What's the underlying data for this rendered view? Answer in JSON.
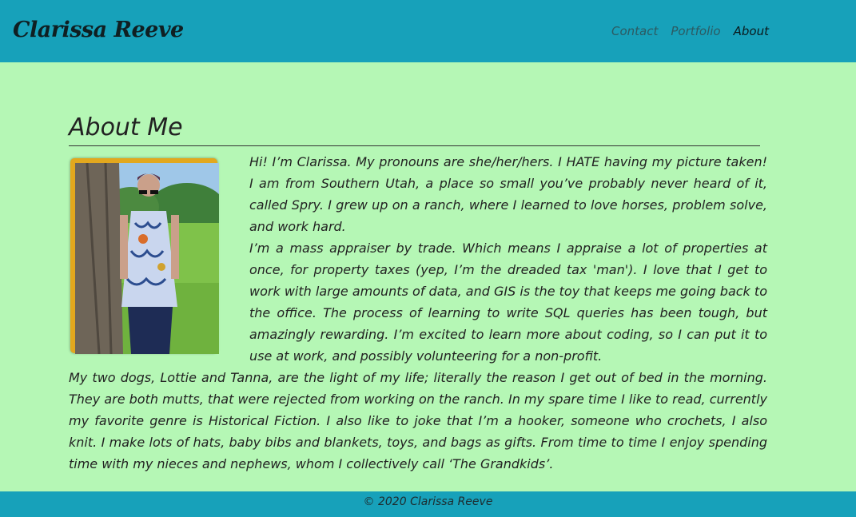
{
  "header": {
    "brand": "Clarissa Reeve",
    "nav": [
      "Contact",
      "Portfolio",
      "About"
    ],
    "active": "About"
  },
  "main": {
    "title": "About Me",
    "paragraphs": [
      "Hi! I’m Clarissa. My pronouns are she/her/hers. I HATE having my picture taken! I am from Southern Utah, a place so small you’ve probably never heard of it, called Spry. I grew up on a ranch, where I learned to love horses, problem solve, and work hard.",
      "I’m a mass appraiser by trade. Which means I appraise a lot of properties at once, for property taxes (yep, I’m the dreaded tax 'man'). I love that I get to work with large amounts of data, and GIS is the toy that keeps me going back to the office. The process of learning to write SQL queries has been tough, but amazingly rewarding. I’m excited to learn more about coding, so I can put it to use at work, and possibly volunteering for a non-profit.",
      "My two dogs, Lottie and Tanna, are the light of my life; literally the reason I get out of bed in the morning. They are both mutts, that were rejected from working on the ranch. In my spare time I like to read, currently my favorite genre is Historical Fiction. I also like to joke that I’m a hooker, someone who crochets, I also knit. I make lots of hats, baby bibs and blankets, toys, and bags as gifts. From time to time I enjoy spending time with my nieces and nephews, whom I collectively call ‘The Grandkids’."
    ]
  },
  "footer": {
    "text": "© 2020 Clarissa Reeve"
  }
}
